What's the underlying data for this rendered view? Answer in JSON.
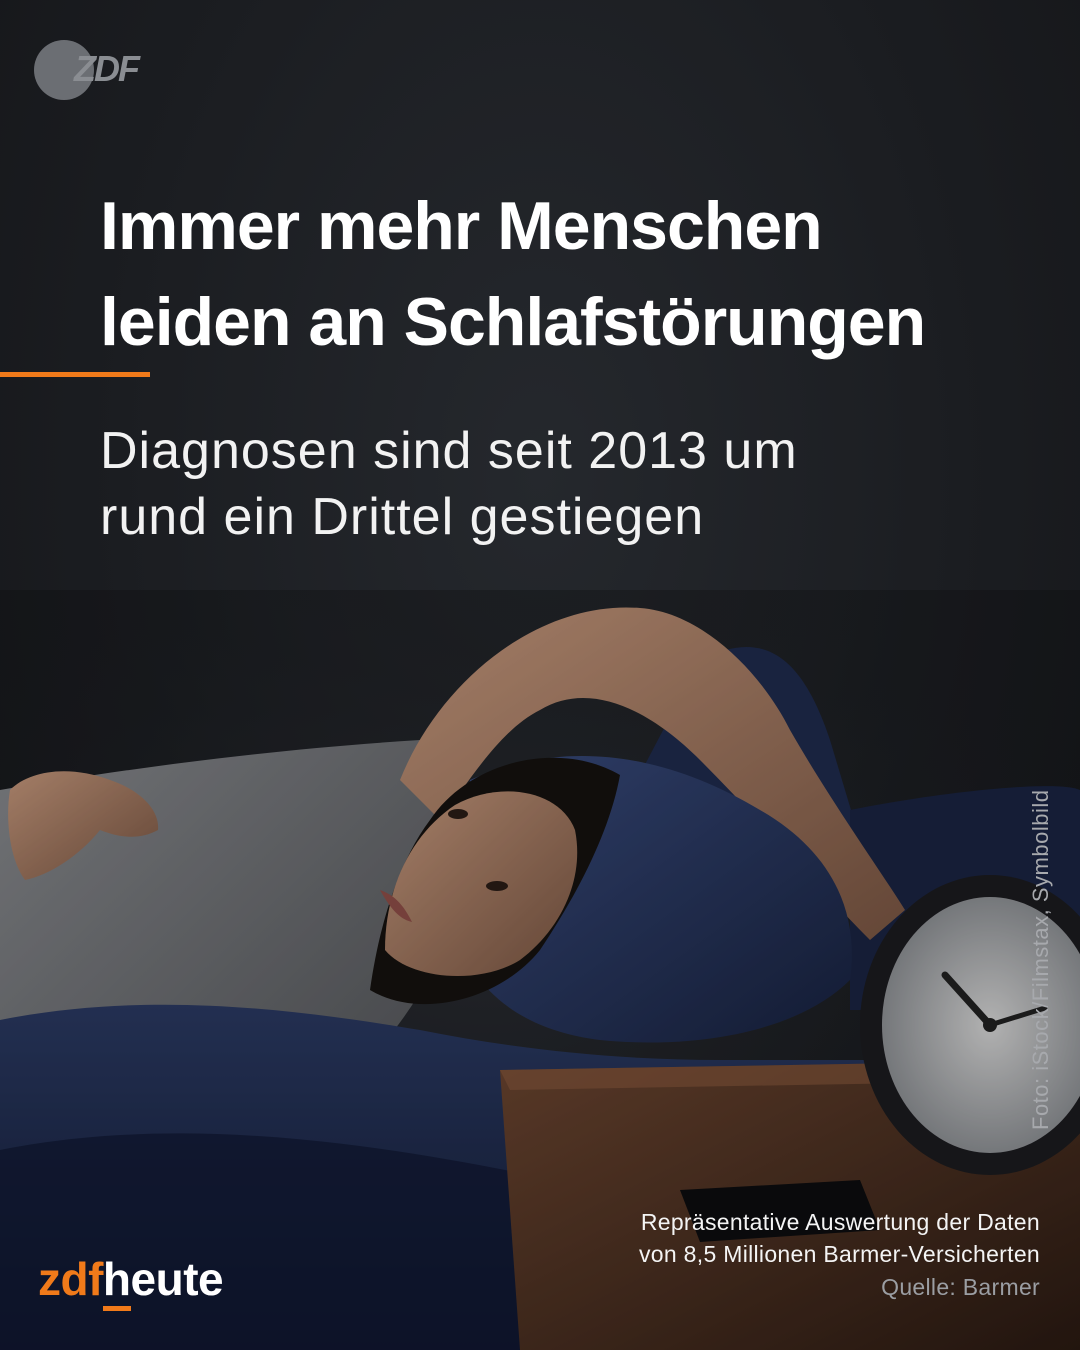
{
  "logo_top": "ZDF",
  "headline": {
    "line1": "Immer mehr Menschen",
    "line2": "leiden an Schlafstörungen"
  },
  "subline": {
    "line1": "Diagnosen sind seit 2013 um",
    "line2": "rund ein Drittel gestiegen"
  },
  "photo": {
    "credit": "Foto: iStock/Filmstax, Symbolbild"
  },
  "source": {
    "line1": "Repräsentative Auswertung der Daten",
    "line2": "von 8,5 Millionen Barmer-Versicherten",
    "label": "Quelle: Barmer"
  },
  "brand": {
    "part1": "zdf",
    "part2": "heute"
  },
  "colors": {
    "accent": "#f07a1a",
    "background": "#1c1e22",
    "text": "#ffffff"
  }
}
